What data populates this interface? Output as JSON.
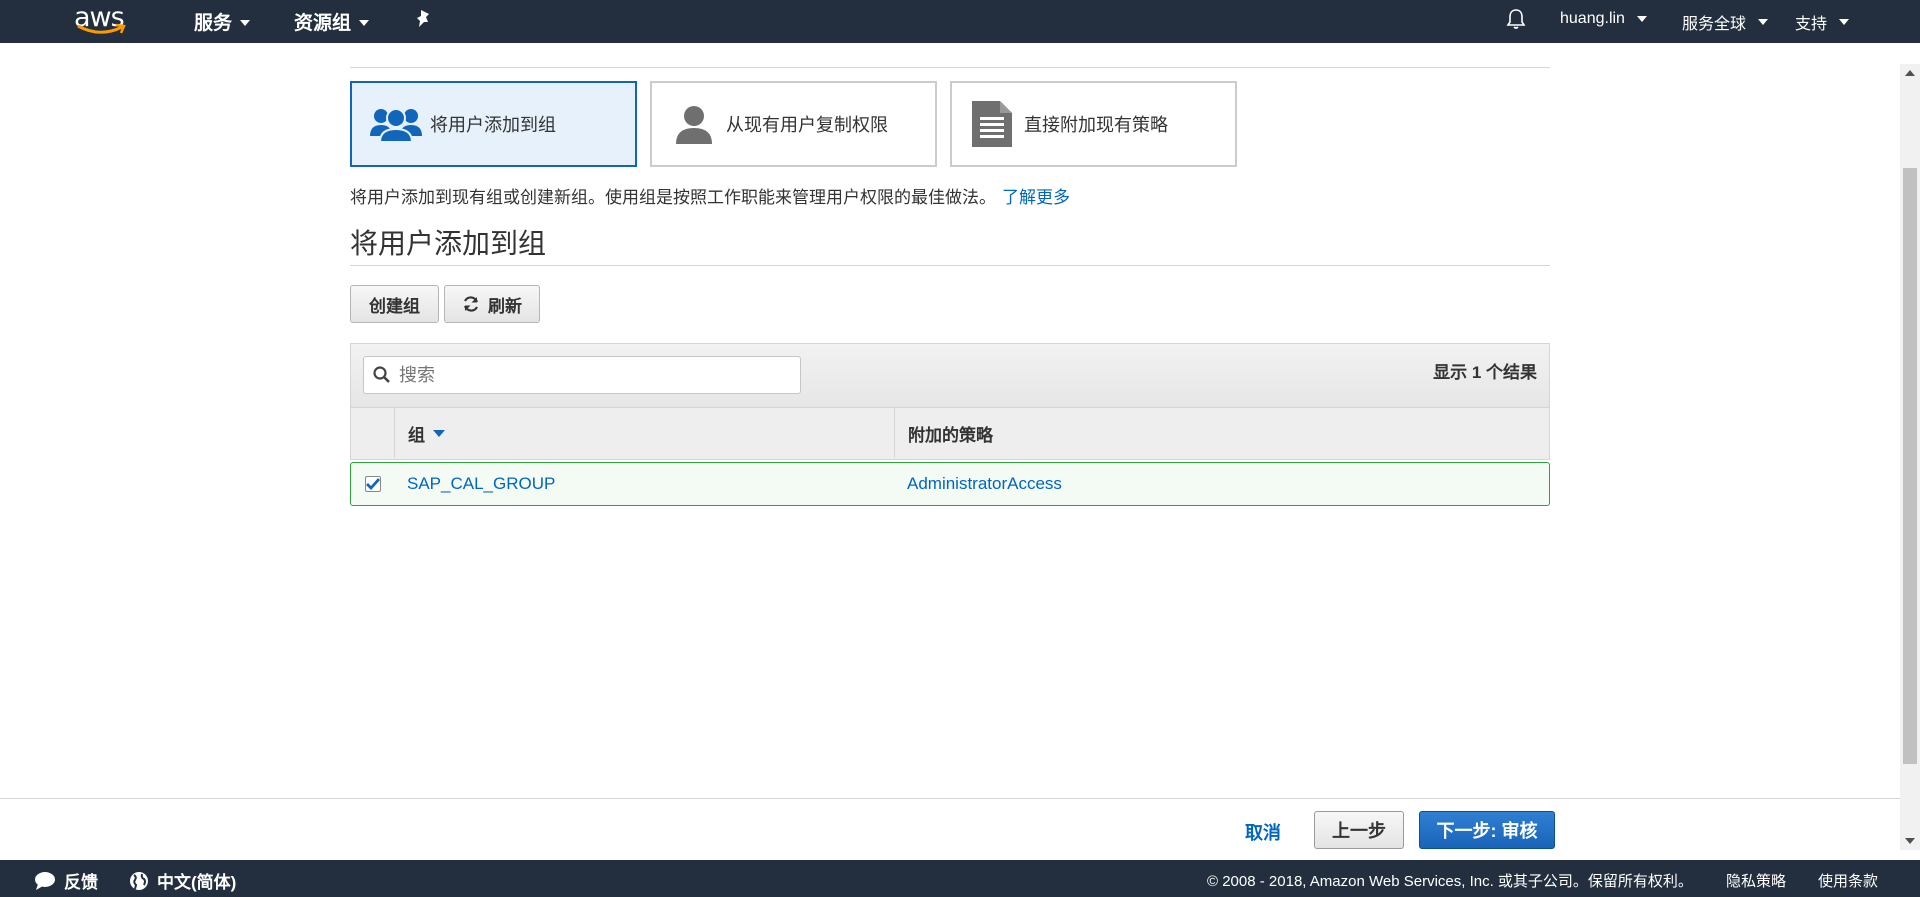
{
  "topnav": {
    "logo_text": "aws",
    "services": "服务",
    "resource_groups": "资源组",
    "user": "huang.lin",
    "region": "服务全球",
    "support": "支持"
  },
  "options": [
    {
      "label": "将用户添加到组",
      "icon": "users-group-icon",
      "selected": true
    },
    {
      "label": "从现有用户复制权限",
      "icon": "user-icon",
      "selected": false
    },
    {
      "label": "直接附加现有策略",
      "icon": "document-icon",
      "selected": false
    }
  ],
  "description": {
    "text": "将用户添加到现有组或创建新组。使用组是按照工作职能来管理用户权限的最佳做法。",
    "link": "了解更多"
  },
  "section_title": "将用户添加到组",
  "buttons": {
    "create_group": "创建组",
    "refresh": "刷新"
  },
  "table": {
    "search_placeholder": "搜索",
    "result_count": "显示 1 个结果",
    "columns": {
      "group": "组",
      "policies": "附加的策略"
    },
    "rows": [
      {
        "group": "SAP_CAL_GROUP",
        "policy": "AdministratorAccess",
        "checked": true
      }
    ]
  },
  "actions": {
    "cancel": "取消",
    "previous": "上一步",
    "next": "下一步: 审核"
  },
  "footer": {
    "feedback": "反馈",
    "language": "中文(简体)",
    "copyright": "© 2008 - 2018, Amazon Web Services, Inc. 或其子公司。保留所有权利。",
    "privacy": "隐私策略",
    "terms": "使用条款"
  },
  "colors": {
    "nav_bg": "#232f3e",
    "link": "#0066c0",
    "selected_border": "#1166bb",
    "row_border": "#2ea440",
    "primary_button": "#1a64b8"
  }
}
